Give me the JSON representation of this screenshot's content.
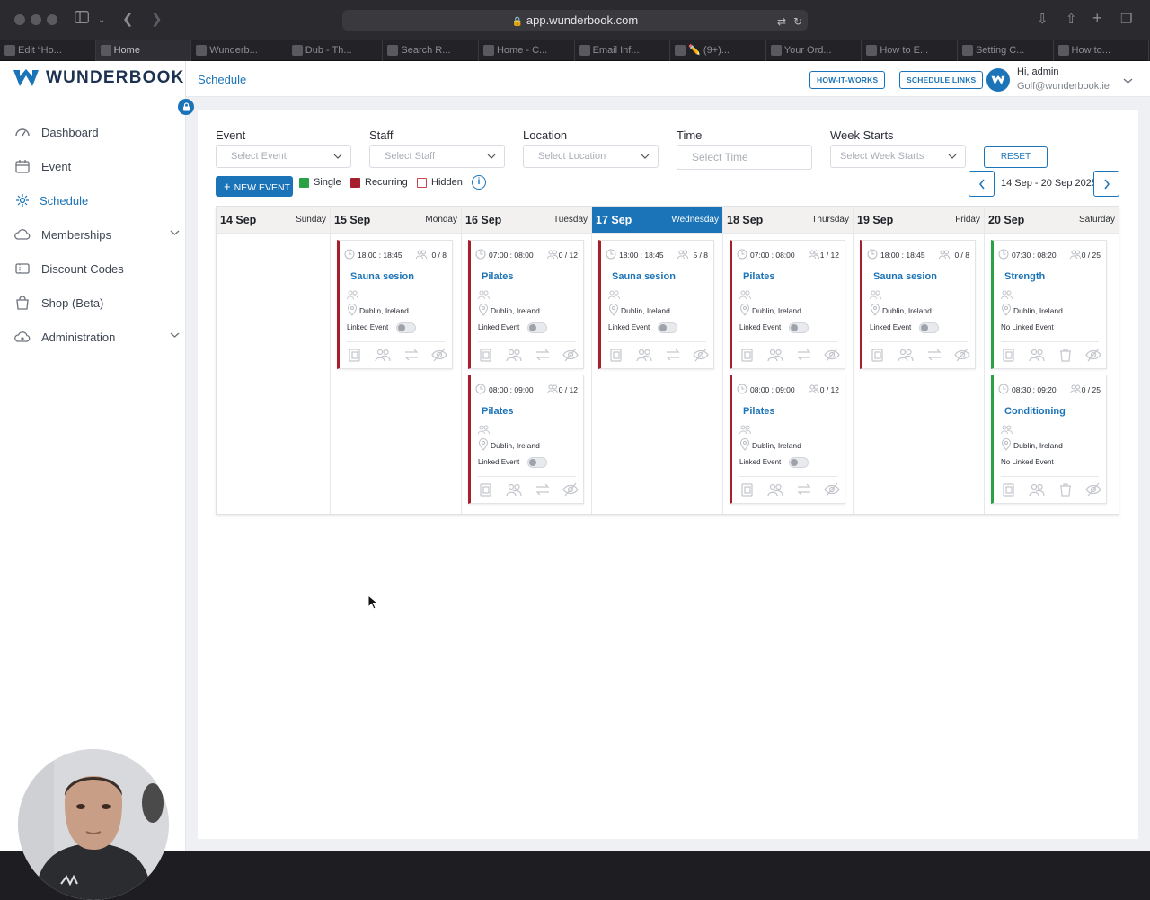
{
  "browser": {
    "url": "app.wunderbook.com",
    "tabs": [
      {
        "label": "Edit “Ho..."
      },
      {
        "label": "Home"
      },
      {
        "label": "Wunderb..."
      },
      {
        "label": "Dub - Th..."
      },
      {
        "label": "Search R..."
      },
      {
        "label": "Home - C..."
      },
      {
        "label": "Email Inf..."
      },
      {
        "label": "✏️ (9+)..."
      },
      {
        "label": "Your Ord..."
      },
      {
        "label": "How to E..."
      },
      {
        "label": "Setting C..."
      },
      {
        "label": "How to..."
      }
    ]
  },
  "brand": {
    "name": "WUNDERBOOK",
    "color": "#1c74b8"
  },
  "sidebar": {
    "items": [
      {
        "label": "Dashboard",
        "icon": "gauge-icon"
      },
      {
        "label": "Event",
        "icon": "calendar-icon"
      },
      {
        "label": "Schedule",
        "icon": "schedule-icon",
        "active": true
      },
      {
        "label": "Memberships",
        "icon": "cloud-membership-icon",
        "has_children": true
      },
      {
        "label": "Discount Codes",
        "icon": "ticket-icon"
      },
      {
        "label": "Shop (Beta)",
        "icon": "bag-icon"
      },
      {
        "label": "Administration",
        "icon": "cloud-admin-icon",
        "has_children": true
      }
    ]
  },
  "header": {
    "breadcrumb": "Schedule",
    "how_it_works": "HOW-IT-WORKS",
    "schedule_links": "SCHEDULE LINKS",
    "greeting": "Hi, admin",
    "email": "Golf@wunderbook.ie"
  },
  "filters": {
    "event": {
      "label": "Event",
      "placeholder": "Select Event"
    },
    "staff": {
      "label": "Staff",
      "placeholder": "Select Staff"
    },
    "location": {
      "label": "Location",
      "placeholder": "Select Location"
    },
    "time": {
      "label": "Time",
      "placeholder": "Select Time"
    },
    "week_starts": {
      "label": "Week Starts",
      "placeholder": "Select Week Starts"
    },
    "reset": "RESET"
  },
  "toolbar": {
    "new_event": "NEW EVENT",
    "legend": {
      "single": "Single",
      "recurring": "Recurring",
      "hidden": "Hidden"
    },
    "range": "14 Sep - 20 Sep 2025"
  },
  "colors": {
    "single": "#2ba246",
    "recurring": "#a51f2d",
    "hidden_border": "#c9414c",
    "today": "#1c74b8"
  },
  "calendar": {
    "days": [
      {
        "date": "14 Sep",
        "day": "Sunday",
        "today": false,
        "events": []
      },
      {
        "date": "15 Sep",
        "day": "Monday",
        "today": false,
        "events": [
          {
            "time": "18:00 : 18:45",
            "capacity": "0 / 8",
            "title": "Sauna sesion",
            "location": "Dublin, Ireland",
            "linked": "Linked Event",
            "type": "recurring"
          }
        ]
      },
      {
        "date": "16 Sep",
        "day": "Tuesday",
        "today": false,
        "events": [
          {
            "time": "07:00 : 08:00",
            "capacity": "0 / 12",
            "title": "Pilates",
            "location": "Dublin, Ireland",
            "linked": "Linked Event",
            "type": "recurring"
          },
          {
            "time": "08:00 : 09:00",
            "capacity": "0 / 12",
            "title": "Pilates",
            "location": "Dublin, Ireland",
            "linked": "Linked Event",
            "type": "recurring"
          }
        ]
      },
      {
        "date": "17 Sep",
        "day": "Wednesday",
        "today": true,
        "events": [
          {
            "time": "18:00 : 18:45",
            "capacity": "5 / 8",
            "title": "Sauna sesion",
            "location": "Dublin, Ireland",
            "linked": "Linked Event",
            "type": "recurring"
          }
        ]
      },
      {
        "date": "18 Sep",
        "day": "Thursday",
        "today": false,
        "events": [
          {
            "time": "07:00 : 08:00",
            "capacity": "1 / 12",
            "title": "Pilates",
            "location": "Dublin, Ireland",
            "linked": "Linked Event",
            "type": "recurring"
          },
          {
            "time": "08:00 : 09:00",
            "capacity": "0 / 12",
            "title": "Pilates",
            "location": "Dublin, Ireland",
            "linked": "Linked Event",
            "type": "recurring"
          }
        ]
      },
      {
        "date": "19 Sep",
        "day": "Friday",
        "today": false,
        "events": [
          {
            "time": "18:00 : 18:45",
            "capacity": "0 / 8",
            "title": "Sauna sesion",
            "location": "Dublin, Ireland",
            "linked": "Linked Event",
            "type": "recurring"
          }
        ]
      },
      {
        "date": "20 Sep",
        "day": "Saturday",
        "today": false,
        "events": [
          {
            "time": "07:30 : 08:20",
            "capacity": "0 / 25",
            "title": "Strength",
            "location": "Dublin, Ireland",
            "linked": "No Linked Event",
            "type": "single"
          },
          {
            "time": "08:30 : 09:20",
            "capacity": "0 / 25",
            "title": "Conditioning",
            "location": "Dublin, Ireland",
            "linked": "No Linked Event",
            "type": "single"
          }
        ]
      }
    ]
  }
}
